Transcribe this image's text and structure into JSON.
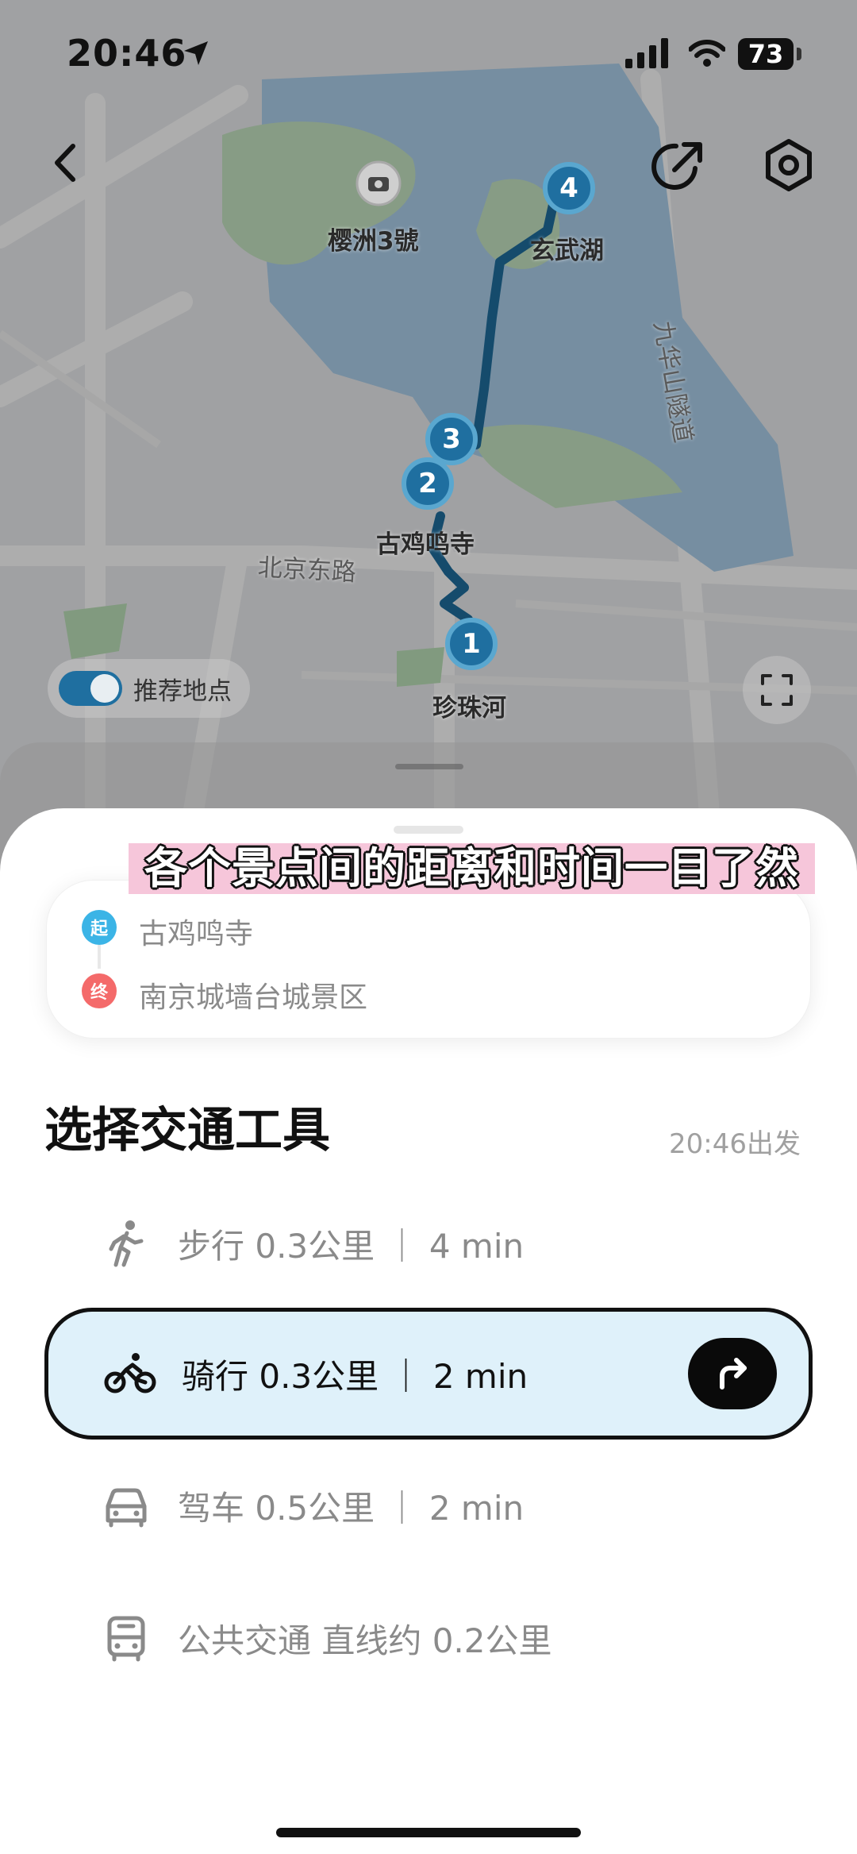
{
  "status_bar": {
    "time": "20:46",
    "battery": "73"
  },
  "map": {
    "labels": {
      "yingzhou": "樱洲3號",
      "xuanwuhu": "玄武湖",
      "gujiming": "古鸡鸣寺",
      "beijing_road": "北京东路",
      "zhenzhuhe": "珍珠河",
      "jiuhuashan_tunnel": "九华山隧道"
    },
    "markers": [
      "1",
      "2",
      "3",
      "4"
    ],
    "toggle_label": "推荐地点"
  },
  "caption": "各个景点间的距离和时间一目了然",
  "route": {
    "start_badge": "起",
    "start": "古鸡鸣寺",
    "end_badge": "终",
    "end": "南京城墙台城景区",
    "start_color": "#3bb4e6",
    "end_color": "#f46a6a"
  },
  "transport": {
    "title": "选择交通工具",
    "depart": "20:46出发",
    "options": [
      {
        "label": "步行 0.3公里 ｜ 4 min",
        "icon": "walk-icon"
      },
      {
        "label": "骑行 0.3公里 ｜ 2 min",
        "icon": "bike-icon",
        "selected": true
      },
      {
        "label": "驾车 0.5公里 ｜ 2 min",
        "icon": "car-icon"
      },
      {
        "label": "公共交通 直线约 0.2公里",
        "icon": "bus-icon"
      }
    ]
  }
}
